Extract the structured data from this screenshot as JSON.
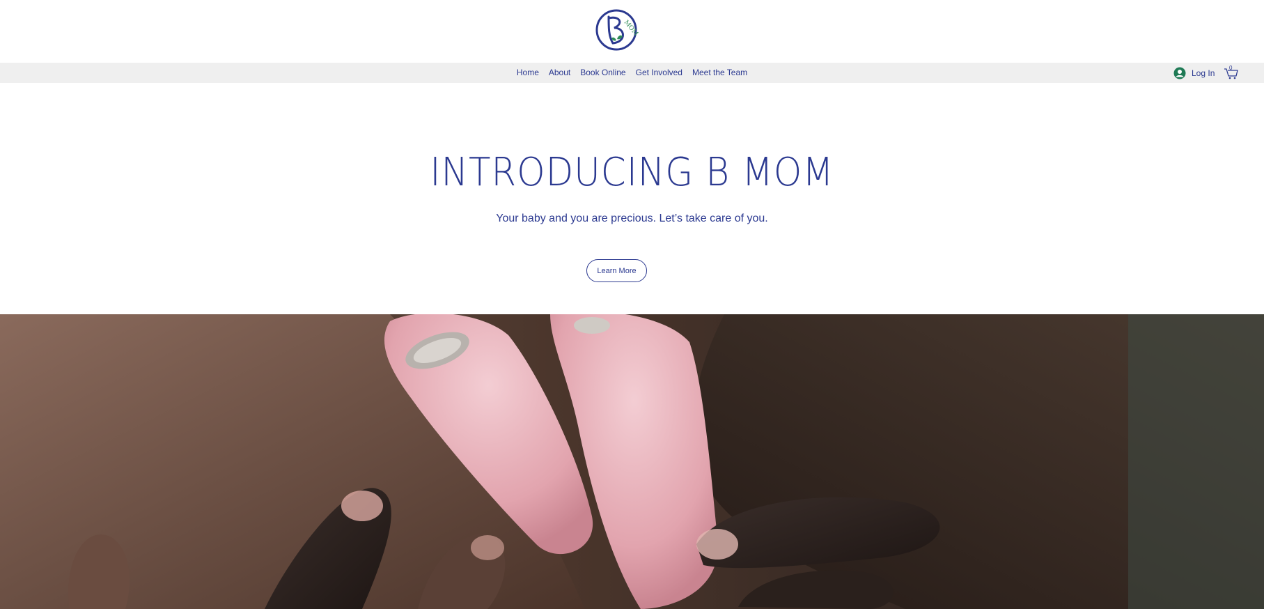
{
  "header": {
    "logo_text": "MOM"
  },
  "nav": {
    "items": [
      {
        "label": "Home"
      },
      {
        "label": "About"
      },
      {
        "label": "Book Online"
      },
      {
        "label": "Get Involved"
      },
      {
        "label": "Meet the Team"
      }
    ],
    "login_label": "Log In",
    "cart_count": "0"
  },
  "hero": {
    "title": "INTRODUCING B MOM",
    "subtitle": "Your baby and you are precious. Let’s take care of you.",
    "cta_label": "Learn More"
  },
  "colors": {
    "brand_blue": "#2b3990",
    "accent_green": "#2e8b57",
    "nav_bg": "#efefef"
  }
}
